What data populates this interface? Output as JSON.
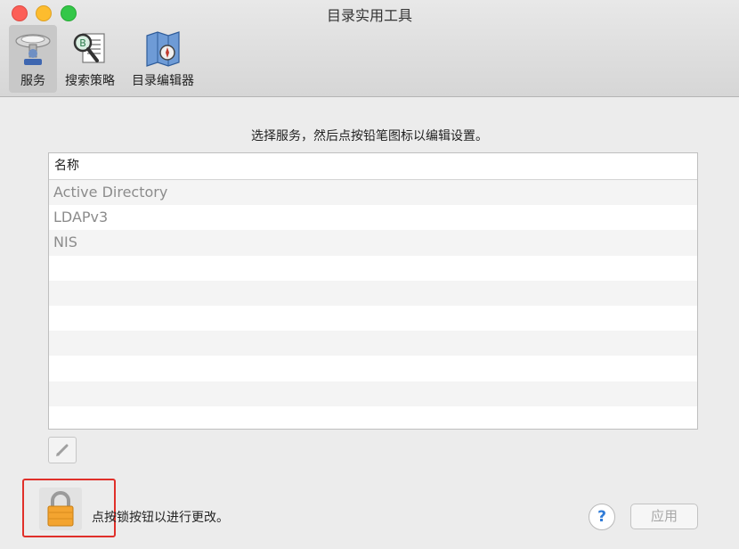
{
  "window": {
    "title": "目录实用工具"
  },
  "toolbar": {
    "items": [
      {
        "label": "服务",
        "icon": "services-icon",
        "selected": true
      },
      {
        "label": "搜索策略",
        "icon": "search-policy-icon",
        "selected": false
      },
      {
        "label": "目录编辑器",
        "icon": "directory-editor-icon",
        "selected": false
      }
    ]
  },
  "main": {
    "instruction": "选择服务，然后点按铅笔图标以编辑设置。",
    "table": {
      "header": "名称",
      "rows": [
        "Active Directory",
        "LDAPv3",
        "NIS"
      ]
    },
    "edit_icon": "pencil-icon"
  },
  "footer": {
    "lock_text": "点按锁按钮以进行更改。",
    "lock_icon": "lock-icon",
    "help_label": "?",
    "apply_label": "应用"
  },
  "colors": {
    "highlight_box": "#e0302a",
    "close": "#fc5f57",
    "minimize": "#fdbc2e",
    "maximize": "#33c748"
  }
}
